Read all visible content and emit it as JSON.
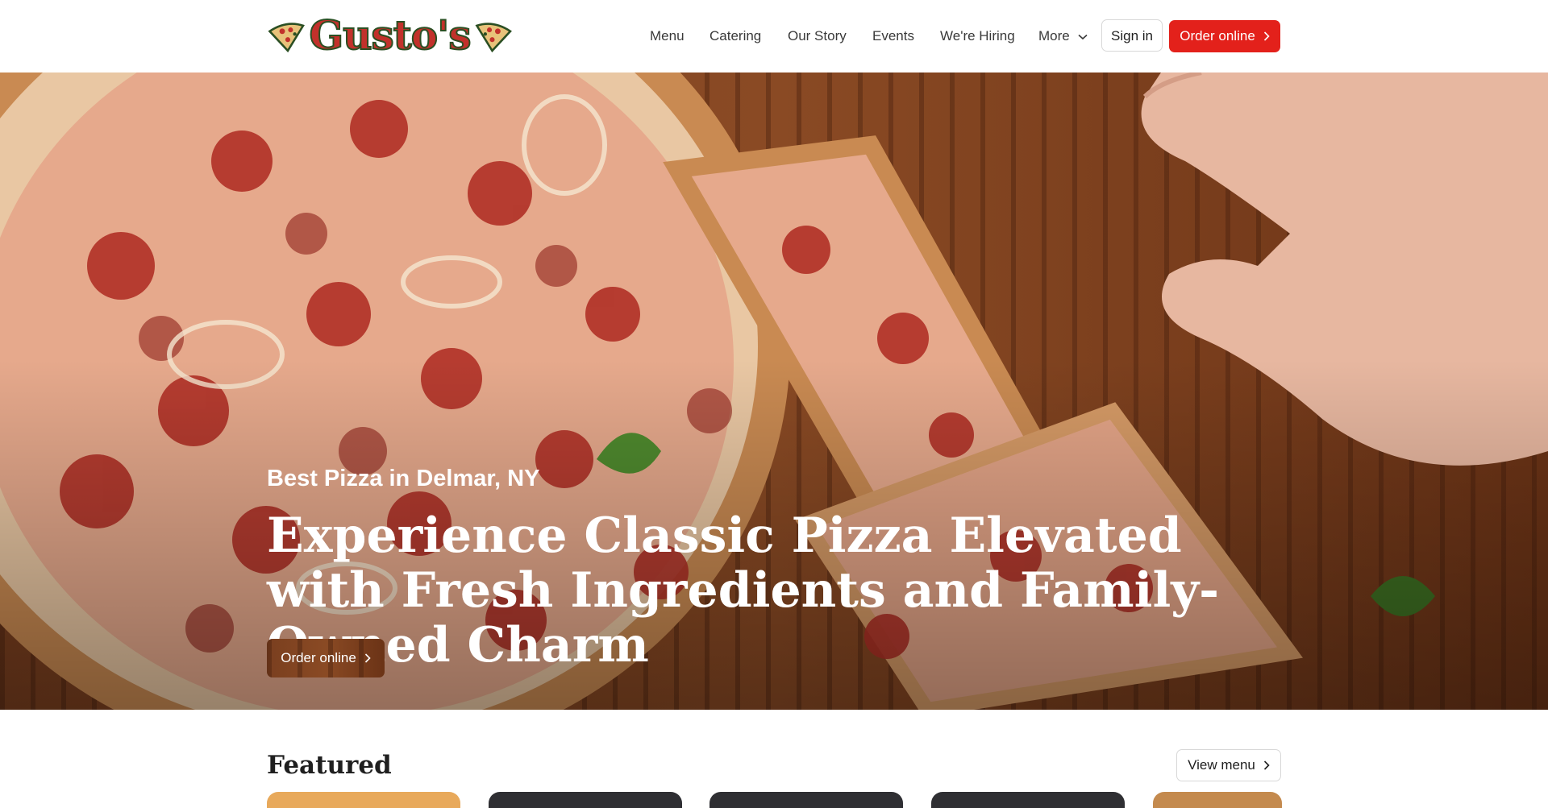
{
  "brand": {
    "logo_text": "Gusto's"
  },
  "nav": {
    "items": [
      {
        "label": "Menu"
      },
      {
        "label": "Catering"
      },
      {
        "label": "Our Story"
      },
      {
        "label": "Events"
      },
      {
        "label": "We're Hiring"
      },
      {
        "label": "More"
      }
    ],
    "sign_in": "Sign in",
    "order_online": "Order online"
  },
  "hero": {
    "subtitle": "Best Pizza in Delmar, NY",
    "title": "Experience Classic Pizza Elevated with Fresh Ingredients and Family-Owned Charm",
    "cta": "Order online"
  },
  "featured": {
    "title": "Featured",
    "view_menu": "View menu"
  },
  "icons": {
    "more_dropdown": "chevron-down-icon",
    "button_arrow": "chevron-right-icon"
  },
  "colors": {
    "accent": "#e3211b",
    "logo_red": "#c2312b",
    "logo_green": "#2b4f23"
  }
}
